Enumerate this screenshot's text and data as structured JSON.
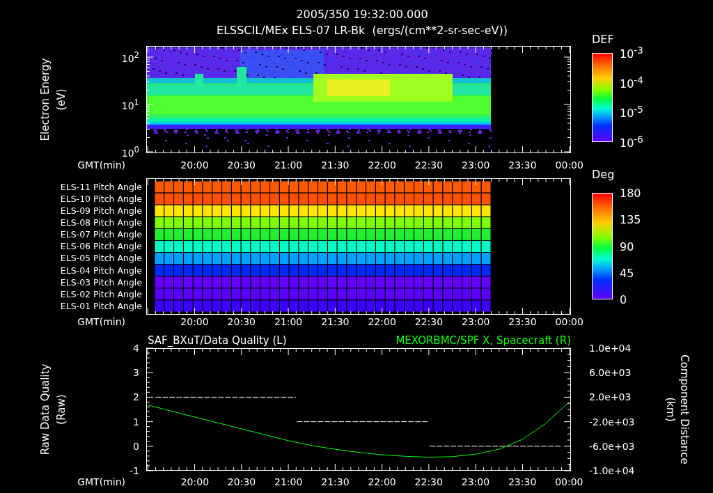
{
  "header": {
    "time": "2005/350 19:32:00.000",
    "title": "ELSSCIL/MEx ELS-07 LR-Bk  (ergs/(cm**2-sr-sec-eV))"
  },
  "spectrogram": {
    "ylabel": [
      "Electron Energy",
      "(eV)"
    ],
    "yticks": [
      "10$^{2}$",
      "10$^{1}$",
      "10$^{0}$"
    ],
    "colorbar": {
      "title": "DEF",
      "labels": [
        "10$^{-3}$",
        "10$^{-4}$",
        "10$^{-5}$",
        "10$^{-6}$"
      ]
    },
    "time_axis": {
      "label": "GMT(min)",
      "ticks": [
        "20:00",
        "20:30",
        "21:00",
        "21:30",
        "22:00",
        "22:30",
        "23:00",
        "23:30",
        "00:00"
      ]
    }
  },
  "pitch_angles": {
    "rows": [
      {
        "label": "ELS-11 Pitch Angle",
        "color": "#ff5a00"
      },
      {
        "label": "ELS-10 Pitch Angle",
        "color": "#ff5000"
      },
      {
        "label": "ELS-09 Pitch Angle",
        "color": "#ffe600"
      },
      {
        "label": "ELS-08 Pitch Angle",
        "color": "#80ff00"
      },
      {
        "label": "ELS-07 Pitch Angle",
        "color": "#20f030"
      },
      {
        "label": "ELS-06 Pitch Angle",
        "color": "#00ffc8"
      },
      {
        "label": "ELS-05 Pitch Angle",
        "color": "#00a0ff"
      },
      {
        "label": "ELS-04 Pitch Angle",
        "color": "#0028ff"
      },
      {
        "label": "ELS-03 Pitch Angle",
        "color": "#6400ff"
      },
      {
        "label": "ELS-02 Pitch Angle",
        "color": "#5a00ff"
      },
      {
        "label": "ELS-01 Pitch Angle",
        "color": "#3c00ff"
      }
    ],
    "colorbar": {
      "title": "Deg",
      "labels": [
        "180",
        "135",
        "90",
        "45",
        "0"
      ]
    },
    "time_axis": {
      "label": "GMT(min)",
      "ticks": [
        "20:00",
        "20:30",
        "21:00",
        "21:30",
        "22:00",
        "22:30",
        "23:00",
        "23:30",
        "00:00"
      ]
    }
  },
  "quality_plot": {
    "title_left": "SAF_BXuT/Data Quality (L)",
    "title_right": "MEXORBMC/SPF X, Spacecraft (R)",
    "ylabel": [
      "Raw Data Quality",
      "(Raw)"
    ],
    "y2label": [
      "Component Distance",
      "(km)"
    ],
    "chart_data": {
      "type": "line",
      "xlabel": "GMT(min)",
      "xlim": [
        19.48,
        24.02
      ],
      "xticks": [
        {
          "value": 20,
          "label": "20:00"
        },
        {
          "value": 20.5,
          "label": "20:30"
        },
        {
          "value": 21,
          "label": "21:00"
        },
        {
          "value": 21.5,
          "label": "21:30"
        },
        {
          "value": 22,
          "label": "22:00"
        },
        {
          "value": 22.5,
          "label": "22:30"
        },
        {
          "value": 23,
          "label": "23:00"
        },
        {
          "value": 23.5,
          "label": "23:30"
        },
        {
          "value": 24,
          "label": "00:00"
        }
      ],
      "ylim": [
        -1,
        4
      ],
      "yticks": [
        4,
        3,
        2,
        1,
        0,
        -1
      ],
      "y2lim": [
        -10000,
        10000
      ],
      "y2ticks": [
        {
          "value": 10000,
          "label": "1.0e+04"
        },
        {
          "value": 6000,
          "label": "6.0e+03"
        },
        {
          "value": 2000,
          "label": "2.0e+03"
        },
        {
          "value": -2000,
          "label": "-2.0e+03"
        },
        {
          "value": -6000,
          "label": "-6.0e+03"
        },
        {
          "value": -10000,
          "label": "-1.0e+04"
        }
      ],
      "series": [
        {
          "color": "#ffffff",
          "line_style": "dashed",
          "x": [
            19.58,
            21.08,
            21.085,
            21.09,
            22.5,
            22.505,
            22.51,
            23.92
          ],
          "values": [
            2,
            2,
            null,
            1,
            1,
            null,
            0,
            0
          ]
        },
        {
          "color": "#00ff00",
          "axis": "y2",
          "x": [
            19.5,
            19.75,
            20,
            20.25,
            20.5,
            20.75,
            21,
            21.25,
            21.5,
            21.75,
            22,
            22.25,
            22.5,
            22.75,
            23,
            23.25,
            23.5,
            23.75,
            24
          ],
          "values": [
            700,
            -270,
            -1240,
            -2200,
            -3170,
            -4130,
            -5100,
            -5900,
            -6500,
            -7000,
            -7400,
            -7650,
            -7800,
            -7700,
            -7300,
            -6500,
            -4900,
            -2300,
            1200
          ]
        }
      ]
    }
  }
}
